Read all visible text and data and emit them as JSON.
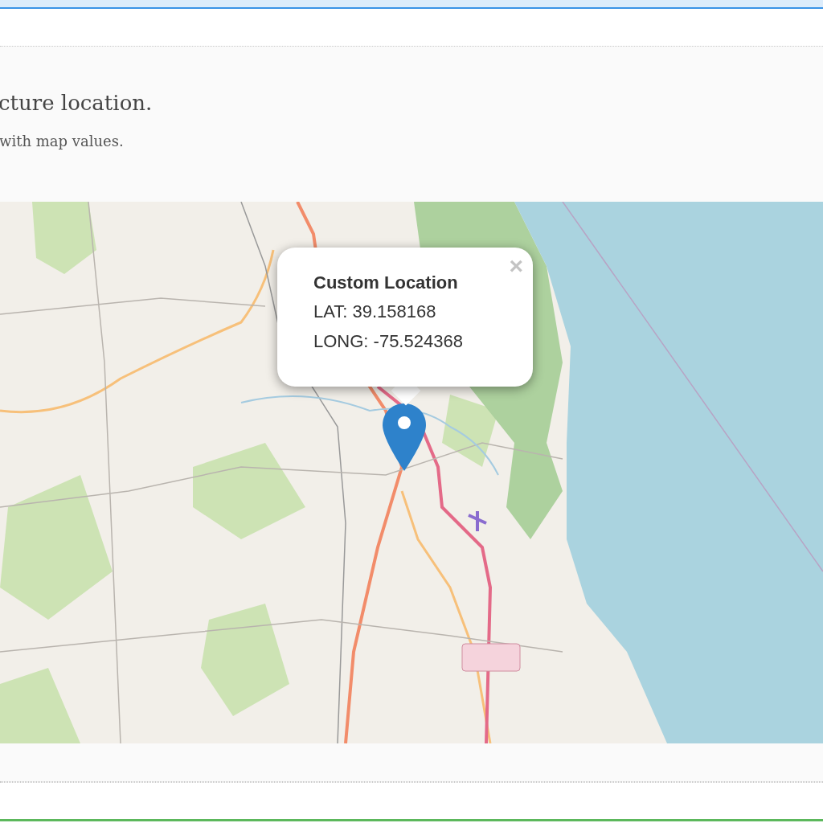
{
  "heading": "cture location.",
  "subheading": "with map values.",
  "popup": {
    "title": "Custom Location",
    "lines": [
      "LAT: 39.158168",
      "LONG: -75.524368"
    ],
    "close": "×"
  }
}
